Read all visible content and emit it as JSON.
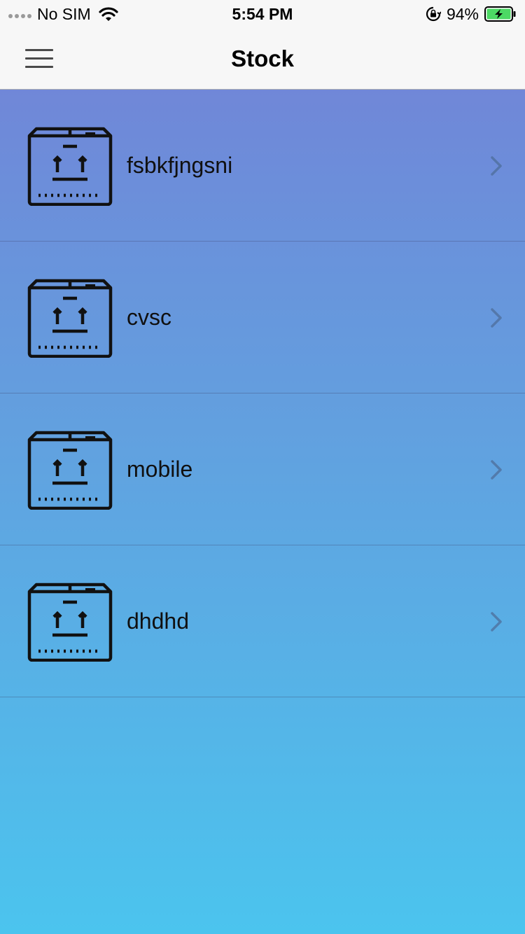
{
  "status_bar": {
    "carrier": "No SIM",
    "time": "5:54 PM",
    "battery": "94%",
    "battery_level": 0.94,
    "battery_color": "#4cd964",
    "icons": [
      "signal-dots-icon",
      "wifi-icon",
      "orientation-lock-icon",
      "battery-charging-icon"
    ]
  },
  "nav": {
    "title": "Stock",
    "menu_icon": "hamburger-menu-icon"
  },
  "items": [
    {
      "label": "fsbkfjngsni",
      "icon": "box-icon"
    },
    {
      "label": "cvsc",
      "icon": "box-icon"
    },
    {
      "label": "mobile",
      "icon": "box-icon"
    },
    {
      "label": "dhdhd",
      "icon": "box-icon"
    }
  ],
  "colors": {
    "gradient_top": "#7087d8",
    "gradient_bottom": "#4bc4ee",
    "nav_background": "#f7f7f7"
  }
}
